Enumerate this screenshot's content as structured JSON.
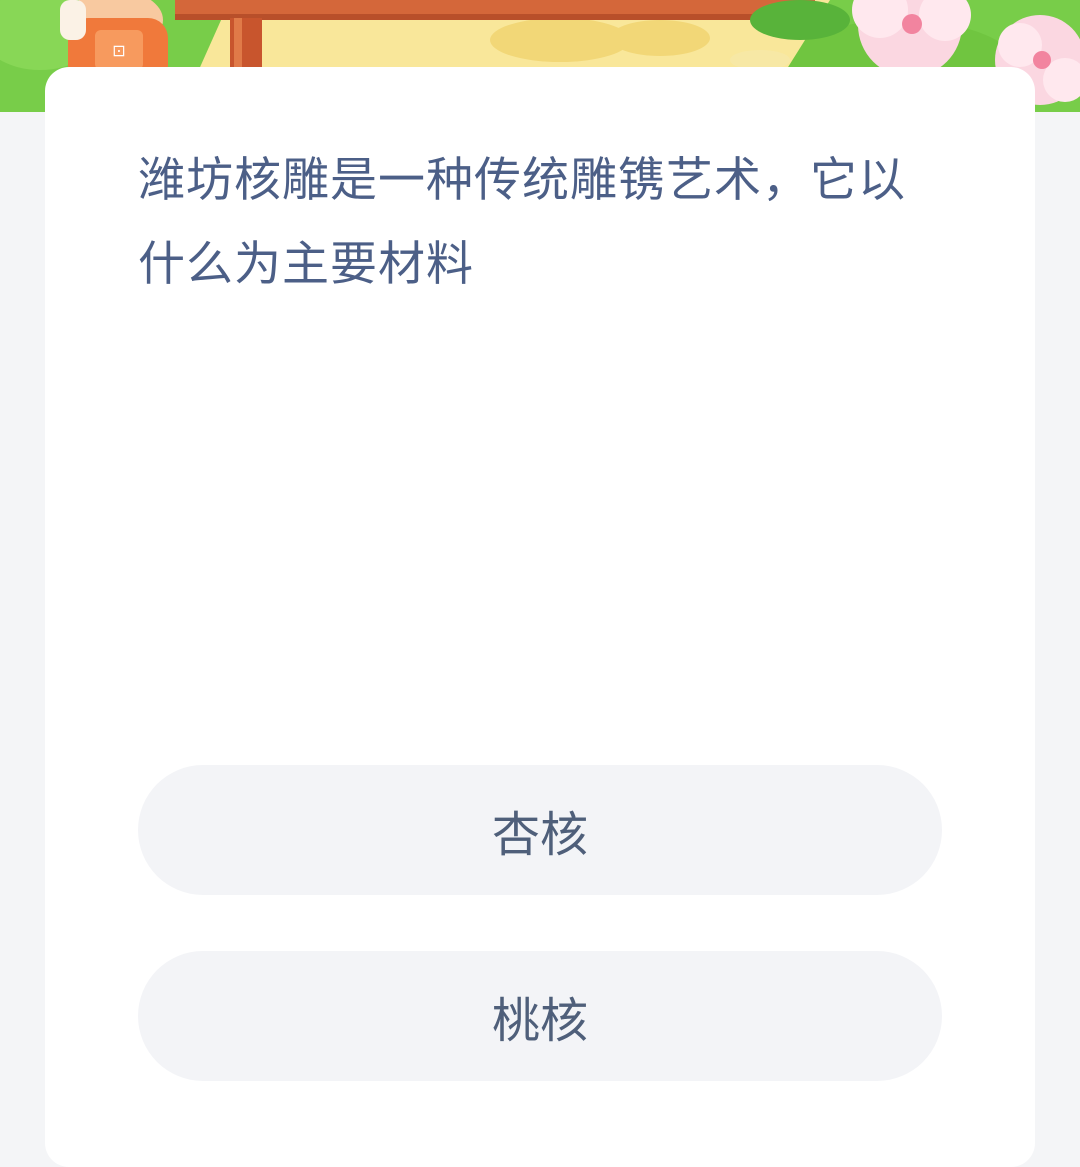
{
  "question": {
    "text": "潍坊核雕是一种传统雕镌艺术，它以什么为主要材料"
  },
  "options": [
    {
      "label": "杏核"
    },
    {
      "label": "桃核"
    }
  ],
  "colors": {
    "page_bg": "#f4f5f7",
    "card_bg": "#ffffff",
    "question_text": "#4c5f87",
    "option_bg": "#f3f4f7",
    "option_text": "#4f5f7a"
  }
}
